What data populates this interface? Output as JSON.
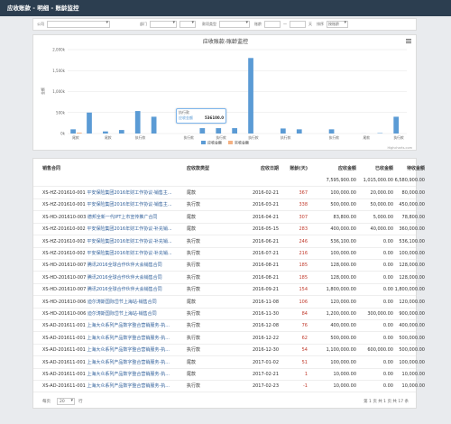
{
  "window": {
    "title": "应收账款 - 明细 - 账龄监控"
  },
  "filters": {
    "company_label": "公司",
    "department_label": "部门",
    "type_label": "款项类型",
    "aging_label": "账龄",
    "aging_sep": "一",
    "aging_unit": "天",
    "sort_label": "排序",
    "sort_value": "按账龄"
  },
  "chart_data": {
    "type": "bar",
    "title": "应收账款-账龄监控",
    "ylabel": "金额",
    "ylim": [
      0,
      2000000
    ],
    "yticks": [
      "0k",
      "500k",
      "1,000k",
      "1,500k",
      "2,000k"
    ],
    "categories": [
      "尾款",
      "执行款",
      "尾款",
      "执行款",
      "执行款",
      "尾款",
      "执行款",
      "执行款",
      "执行款",
      "尾款",
      "执行款",
      "执行款",
      "执行款",
      "尾款",
      "执行款",
      "尾款",
      "尾款",
      "尾款",
      "执行款"
    ],
    "series": [
      {
        "name": "应收金额",
        "color": "#5b9bd5",
        "values": [
          100000,
          500000,
          50000,
          83800,
          536100,
          400000,
          0,
          0,
          128000,
          128000,
          128000,
          1800000,
          0,
          120000,
          100000,
          0,
          100000,
          0,
          1000,
          10000,
          400000
        ]
      },
      {
        "name": "实收金额",
        "color": "#f4b183",
        "values": [
          20000,
          0,
          0,
          0,
          0,
          0,
          0,
          0,
          0,
          0,
          0,
          0,
          0,
          0,
          0,
          0,
          0,
          0,
          0,
          0,
          0
        ]
      }
    ],
    "legend": [
      "应收金额",
      "实收金额"
    ],
    "credits": "Highcharts.com",
    "tooltip": {
      "category": "执行款",
      "series": "应收金额",
      "value": "536100.0"
    }
  },
  "table": {
    "headers": [
      "销售合同",
      "应收款类型",
      "应收日期",
      "账龄(天)",
      "应收金额",
      "已收金额",
      "待收金额"
    ],
    "totals": {
      "ar": "7,595,900.00",
      "received": "1,015,000.00",
      "pending": "6,580,900.00"
    },
    "rows": [
      {
        "contract": "XS-HZ-201610-001",
        "desc": "平安保险集团2016年财工作协议-销售主...",
        "type": "尾款",
        "date": "2016-02-21",
        "aging": "367",
        "ar": "100,000.00",
        "received": "20,000.00",
        "pending": "80,000.00"
      },
      {
        "contract": "XS-HZ-201610-001",
        "desc": "平安保险集团2016年财工作协议-销售主...",
        "type": "执行款",
        "date": "2016-03-21",
        "aging": "338",
        "ar": "500,000.00",
        "received": "50,000.00",
        "pending": "450,000.00"
      },
      {
        "contract": "XS-HD-201610-003",
        "desc": "德邦全新一代IPT上市宣传推广合同",
        "type": "尾款",
        "date": "2016-04-21",
        "aging": "307",
        "ar": "83,800.00",
        "received": "5,000.00",
        "pending": "78,800.00"
      },
      {
        "contract": "XS-HZ-201610-002",
        "desc": "平安保险集团2016年财工作协议-补充销...",
        "type": "尾款",
        "date": "2016-05-15",
        "aging": "283",
        "ar": "400,000.00",
        "received": "40,000.00",
        "pending": "360,000.00"
      },
      {
        "contract": "XS-HZ-201610-002",
        "desc": "平安保险集团2016年财工作协议-补充销...",
        "type": "执行款",
        "date": "2016-06-21",
        "aging": "246",
        "ar": "536,100.00",
        "received": "0.00",
        "pending": "536,100.00"
      },
      {
        "contract": "XS-HZ-201610-002",
        "desc": "平安保险集团2016年财工作协议-补充销...",
        "type": "执行款",
        "date": "2016-07-21",
        "aging": "216",
        "ar": "100,000.00",
        "received": "0.00",
        "pending": "100,000.00"
      },
      {
        "contract": "XS-HD-201610-007",
        "desc": "腾讯2016全球合作伙伴大会销售合同",
        "type": "执行款",
        "date": "2016-08-21",
        "aging": "185",
        "ar": "128,000.00",
        "received": "0.00",
        "pending": "128,000.00"
      },
      {
        "contract": "XS-HD-201610-007",
        "desc": "腾讯2016全球合作伙伴大会销售合同",
        "type": "执行款",
        "date": "2016-08-21",
        "aging": "185",
        "ar": "128,000.00",
        "received": "0.00",
        "pending": "128,000.00"
      },
      {
        "contract": "XS-HD-201610-007",
        "desc": "腾讯2016全球合作伙伴大会销售合同",
        "type": "执行款",
        "date": "2016-09-21",
        "aging": "154",
        "ar": "1,800,000.00",
        "received": "0.00",
        "pending": "1,800,000.00"
      },
      {
        "contract": "XS-HD-201610-006",
        "desc": "迪尔涛斯国际岱节上海站-销售合同",
        "type": "尾款",
        "date": "2016-11-08",
        "aging": "106",
        "ar": "120,000.00",
        "received": "0.00",
        "pending": "120,000.00"
      },
      {
        "contract": "XS-HD-201610-006",
        "desc": "迪尔涛斯国际岱节上海站-销售合同",
        "type": "执行款",
        "date": "2016-11-30",
        "aging": "84",
        "ar": "1,200,000.00",
        "received": "300,000.00",
        "pending": "900,000.00"
      },
      {
        "contract": "XS-AD-201611-001",
        "desc": "上海大众系列产品数字整合营销服务-执...",
        "type": "执行款",
        "date": "2016-12-08",
        "aging": "76",
        "ar": "400,000.00",
        "received": "0.00",
        "pending": "400,000.00"
      },
      {
        "contract": "XS-AD-201611-001",
        "desc": "上海大众系列产品数字整合营销服务-执...",
        "type": "执行款",
        "date": "2016-12-22",
        "aging": "62",
        "ar": "500,000.00",
        "received": "0.00",
        "pending": "500,000.00"
      },
      {
        "contract": "XS-AD-201611-001",
        "desc": "上海大众系列产品数字整合营销服务-执...",
        "type": "执行款",
        "date": "2016-12-30",
        "aging": "54",
        "ar": "1,100,000.00",
        "received": "600,000.00",
        "pending": "500,000.00"
      },
      {
        "contract": "XS-AD-201611-001",
        "desc": "上海大众系列产品数字整合营销服务-执...",
        "type": "尾款",
        "date": "2017-01-02",
        "aging": "51",
        "ar": "100,000.00",
        "received": "0.00",
        "pending": "100,000.00"
      },
      {
        "contract": "XS-AD-201611-001",
        "desc": "上海大众系列产品数字整合营销服务-执...",
        "type": "尾款",
        "date": "2017-02-21",
        "aging": "1",
        "ar": "10,000.00",
        "received": "0.00",
        "pending": "10,000.00"
      },
      {
        "contract": "XS-AD-201611-001",
        "desc": "上海大众系列产品数字整合营销服务-执...",
        "type": "执行款",
        "date": "2017-02-23",
        "aging": "-1",
        "ar": "10,000.00",
        "received": "0.00",
        "pending": "10,000.00"
      }
    ]
  },
  "pager": {
    "per_page_label": "每页",
    "per_page_value": "20",
    "rows_label": "行",
    "status": "第 1 页 共 1 页 共 17 条"
  }
}
